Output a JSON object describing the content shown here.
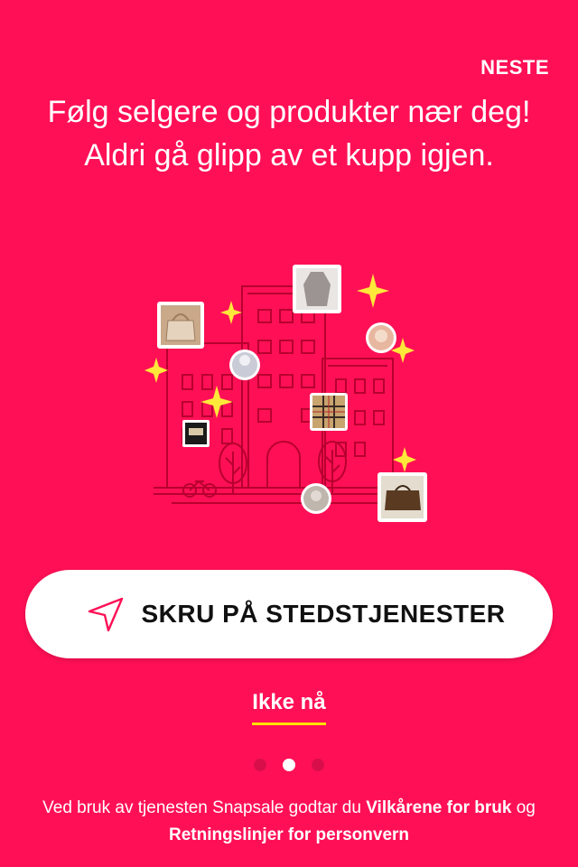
{
  "header": {
    "next_label": "NESTE"
  },
  "headline": "Følg selgere og produkter nær deg! Aldri gå glipp av et kupp igjen.",
  "cta": {
    "label": "SKRU PÅ STEDSTJENESTER",
    "icon": "location-arrow-icon"
  },
  "skip_label": "Ikke nå",
  "pager": {
    "total": 3,
    "active_index": 1
  },
  "legal": {
    "prefix": "Ved bruk av tjenesten Snapsale godtar du ",
    "terms_link": "Vilkårene for bruk",
    "middle": " og ",
    "privacy_link": "Retningslinjer for personvern"
  },
  "colors": {
    "background": "#FF1056",
    "accent_underline": "#FFE100",
    "sparkle": "#FFE83A",
    "line_art": "#B8002F",
    "button_bg": "#FFFFFF",
    "button_text": "#111111"
  }
}
